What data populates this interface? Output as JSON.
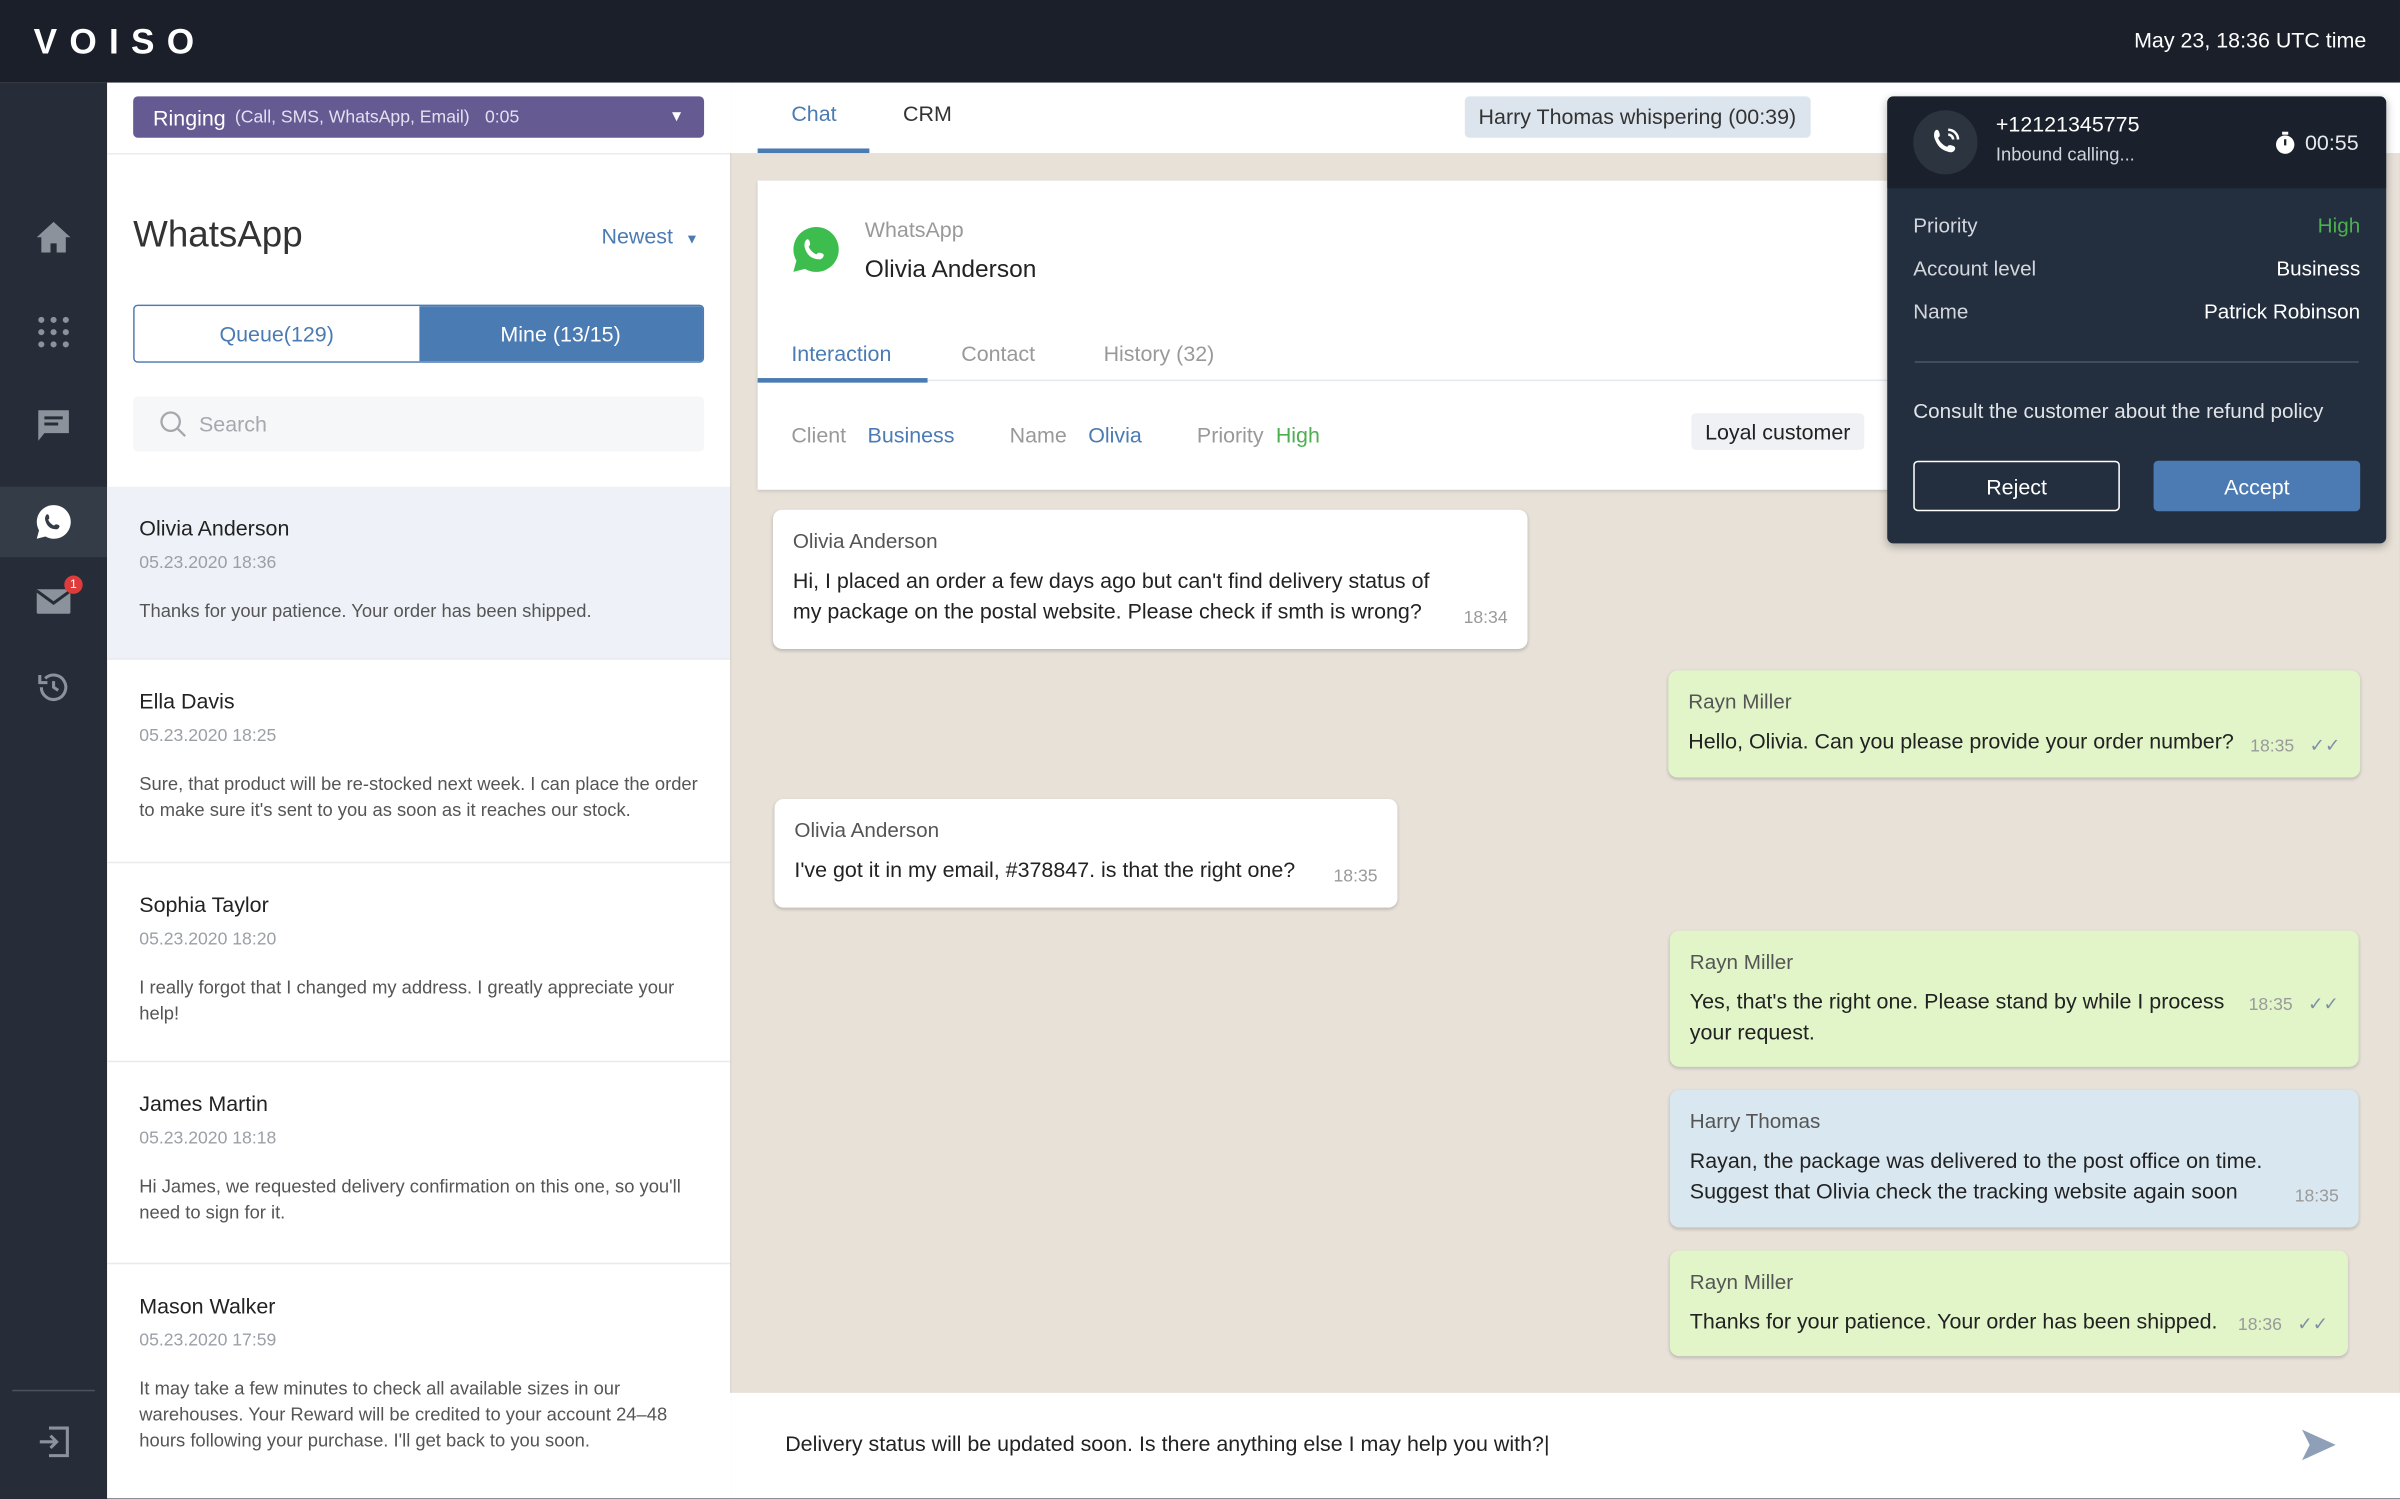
{
  "header": {
    "logo": "VOISO",
    "datetime": "May 23, 18:36 UTC time"
  },
  "sidebar": {
    "items": [
      {
        "icon": "home-icon"
      },
      {
        "icon": "dialpad-icon"
      },
      {
        "icon": "chat-icon"
      },
      {
        "icon": "whatsapp-icon",
        "active": true
      },
      {
        "icon": "mail-icon",
        "badge": "1"
      },
      {
        "icon": "history-icon"
      }
    ],
    "logout_icon": "logout-icon"
  },
  "ringing": {
    "label": "Ringing",
    "channels": "(Call, SMS, WhatsApp, Email)",
    "time": "0:05"
  },
  "list": {
    "title": "WhatsApp",
    "sort": "Newest",
    "tabs": {
      "queue": "Queue(129)",
      "mine": "Mine (13/15)"
    },
    "search_placeholder": "Search",
    "conversations": [
      {
        "name": "Olivia Anderson",
        "date": "05.23.2020 18:36",
        "preview": "Thanks for your patience. Your order has been shipped."
      },
      {
        "name": "Ella Davis",
        "date": "05.23.2020 18:25",
        "preview": "Sure, that product will be re-stocked next week. I can place the order to make sure it's sent to you as soon as it reaches our stock."
      },
      {
        "name": "Sophia Taylor",
        "date": "05.23.2020 18:20",
        "preview": "I really forgot that I changed my address. I greatly appreciate your help!"
      },
      {
        "name": "James Martin",
        "date": "05.23.2020 18:18",
        "preview": "Hi James, we requested delivery confirmation on this one, so you'll need to sign for it."
      },
      {
        "name": "Mason Walker",
        "date": "05.23.2020 17:59",
        "preview": "It may take a few minutes to check all available sizes in our warehouses. Your Reward will be credited to your account 24–48 hours following your purchase. I'll get back to you soon."
      }
    ]
  },
  "main": {
    "tabs": [
      "Chat",
      "CRM"
    ],
    "whisper": "Harry Thomas whispering (00:39)",
    "card": {
      "source": "WhatsApp",
      "name": "Olivia Anderson",
      "tabs": [
        "Interaction",
        "Contact",
        "History (32)"
      ],
      "client_label": "Client",
      "client": "Business",
      "name_label": "Name",
      "name_value": "Olivia",
      "priority_label": "Priority",
      "priority": "High",
      "tag": "Loyal customer"
    },
    "messages": [
      {
        "sender": "Olivia Anderson",
        "text": "Hi, I placed an order a few days ago but can't find delivery status of my package on the postal website. Please check if smth is wrong?",
        "time": "18:34",
        "type": "in"
      },
      {
        "sender": "Rayn Miller",
        "text": "Hello, Olivia. Can you please provide your order number?",
        "time": "18:35",
        "type": "out"
      },
      {
        "sender": "Olivia Anderson",
        "text": "I've got it in my email, #378847. is that the right one?",
        "time": "18:35",
        "type": "in"
      },
      {
        "sender": "Rayn Miller",
        "text": "Yes, that's the right one. Please stand by while I process your request.",
        "time": "18:35",
        "type": "out"
      },
      {
        "sender": "Harry Thomas",
        "text": "Rayan, the package was delivered to the post office on time. Suggest that Olivia check the tracking website again soon",
        "time": "18:35",
        "type": "whisper"
      },
      {
        "sender": "Rayn Miller",
        "text": "Thanks for your patience. Your order has been shipped.",
        "time": "18:36",
        "type": "out"
      }
    ],
    "input": "Delivery status will be updated soon. Is there anything else I may help you with?|"
  },
  "call_popup": {
    "phone": "+12121345775",
    "status": "Inbound calling...",
    "timer": "00:55",
    "priority_label": "Priority",
    "priority": "High",
    "account_label": "Account level",
    "account": "Business",
    "name_label": "Name",
    "name": "Patrick Robinson",
    "note": "Consult the customer about the refund policy",
    "reject": "Reject",
    "accept": "Accept"
  },
  "colors": {
    "accent": "#4b7bb3",
    "ringing": "#665a93",
    "high": "#4caf50",
    "outgoing": "#e1f5c9",
    "whisper": "#d9e7f0"
  }
}
